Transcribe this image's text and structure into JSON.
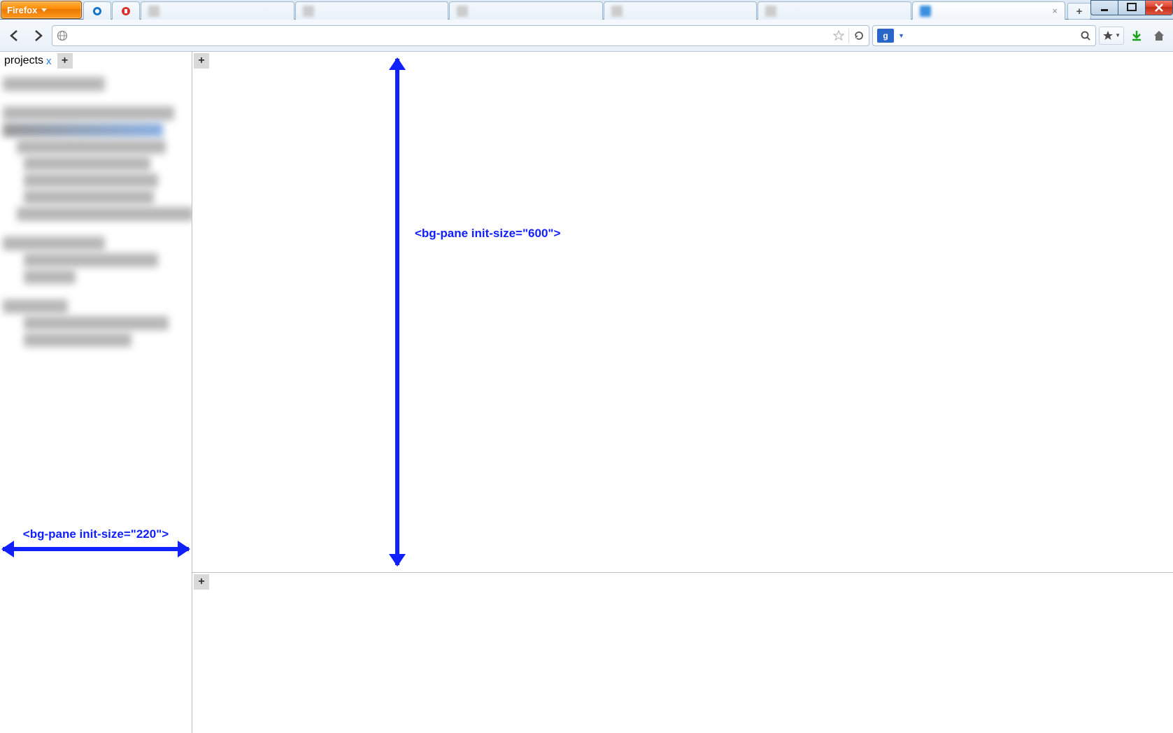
{
  "window": {
    "firefox_label": "Firefox",
    "controls": {
      "min": "minimize",
      "max": "maximize",
      "close": "close"
    }
  },
  "tabs": {
    "pinned_count": 2,
    "items": [
      {
        "label": "",
        "active": false
      },
      {
        "label": "",
        "active": false
      },
      {
        "label": "",
        "active": false
      },
      {
        "label": "",
        "active": false
      },
      {
        "label": "",
        "active": false
      },
      {
        "label": "",
        "active": true,
        "closeable": true
      }
    ],
    "new_tab": "+"
  },
  "navbar": {
    "url_text": "",
    "search_engine_glyph": "g",
    "search_play": ""
  },
  "left_pane": {
    "tab_label": "projects",
    "tab_close": "x",
    "add": "+"
  },
  "top_pane": {
    "add": "+"
  },
  "bottom_pane": {
    "add": "+"
  },
  "annotations": {
    "left": "<bg-pane init-size=\"220\">",
    "top": "<bg-pane init-size=\"600\">"
  }
}
